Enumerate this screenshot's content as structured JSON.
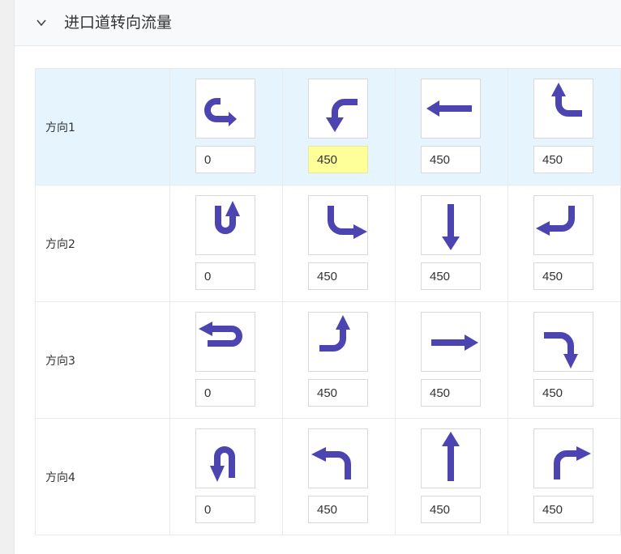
{
  "header": {
    "title": "进口道转向流量"
  },
  "accent_color": "#4b44b1",
  "rows": [
    {
      "label": "方向1",
      "cells": [
        {
          "icon": "u-turn-arrow-icon",
          "value": "0"
        },
        {
          "icon": "turn-left-arrow-icon",
          "value": "450"
        },
        {
          "icon": "straight-left-arrow-icon",
          "value": "450"
        },
        {
          "icon": "turn-right-arrow-icon",
          "value": "450"
        }
      ]
    },
    {
      "label": "方向2",
      "cells": [
        {
          "icon": "u-turn-arrow-icon",
          "value": "0"
        },
        {
          "icon": "turn-left-arrow-icon",
          "value": "450"
        },
        {
          "icon": "straight-down-arrow-icon",
          "value": "450"
        },
        {
          "icon": "turn-right-arrow-icon",
          "value": "450"
        }
      ]
    },
    {
      "label": "方向3",
      "cells": [
        {
          "icon": "u-turn-arrow-icon",
          "value": "0"
        },
        {
          "icon": "turn-left-arrow-icon",
          "value": "450"
        },
        {
          "icon": "straight-right-arrow-icon",
          "value": "450"
        },
        {
          "icon": "turn-right-arrow-icon",
          "value": "450"
        }
      ]
    },
    {
      "label": "方向4",
      "cells": [
        {
          "icon": "u-turn-arrow-icon",
          "value": "0"
        },
        {
          "icon": "turn-left-arrow-icon",
          "value": "450"
        },
        {
          "icon": "straight-up-arrow-icon",
          "value": "450"
        },
        {
          "icon": "turn-right-arrow-icon",
          "value": "450"
        }
      ]
    }
  ]
}
